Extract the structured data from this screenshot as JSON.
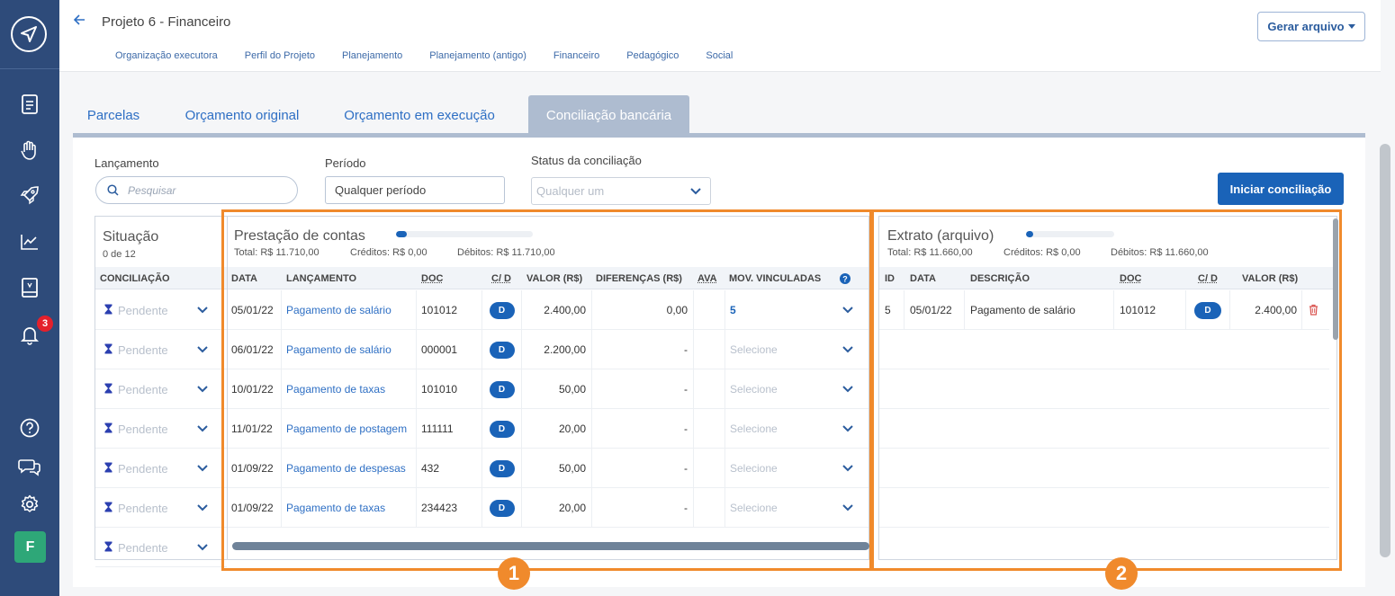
{
  "sidebar": {
    "notification_count": "3",
    "user_initial": "F"
  },
  "header": {
    "title": "Projeto 6 - Financeiro",
    "nav": [
      "Organização executora",
      "Perfil do Projeto",
      "Planejamento",
      "Planejamento (antigo)",
      "Financeiro",
      "Pedagógico",
      "Social"
    ],
    "gerar_label": "Gerar arquivo"
  },
  "tabs": [
    "Parcelas",
    "Orçamento original",
    "Orçamento em execução",
    "Conciliação bancária"
  ],
  "filters": {
    "lancamento_label": "Lançamento",
    "search_placeholder": "Pesquisar",
    "periodo_label": "Período",
    "periodo_value": "Qualquer período",
    "status_label": "Status da conciliação",
    "status_value": "Qualquer um",
    "iniciar_label": "Iniciar conciliação"
  },
  "situacao": {
    "title": "Situação",
    "count": "0 de 12",
    "header": "CONCILIAÇÃO",
    "rows": [
      "Pendente",
      "Pendente",
      "Pendente",
      "Pendente",
      "Pendente",
      "Pendente",
      "Pendente"
    ]
  },
  "prestacao": {
    "title": "Prestação de contas",
    "progress": 0.08,
    "total": "Total: R$ 11.710,00",
    "creditos": "Créditos: R$ 0,00",
    "debitos": "Débitos: R$ 11.710,00",
    "headers": [
      "DATA",
      "LANÇAMENTO",
      "DOC",
      "C/ D",
      "VALOR (R$)",
      "DIFERENÇAS (R$)",
      "AVA",
      "MOV. VINCULADAS"
    ],
    "rows": [
      {
        "data": "05/01/22",
        "lancamento": "Pagamento de salário",
        "doc": "101012",
        "cd": "D",
        "valor": "2.400,00",
        "dif": "0,00",
        "mov": "5"
      },
      {
        "data": "06/01/22",
        "lancamento": "Pagamento de salário",
        "doc": "000001",
        "cd": "D",
        "valor": "2.200,00",
        "dif": "-",
        "mov": "Selecione"
      },
      {
        "data": "10/01/22",
        "lancamento": "Pagamento de taxas",
        "doc": "101010",
        "cd": "D",
        "valor": "50,00",
        "dif": "-",
        "mov": "Selecione"
      },
      {
        "data": "11/01/22",
        "lancamento": "Pagamento de postagem",
        "doc": "111111",
        "cd": "D",
        "valor": "20,00",
        "dif": "-",
        "mov": "Selecione"
      },
      {
        "data": "01/09/22",
        "lancamento": "Pagamento de despesas",
        "doc": "432",
        "cd": "D",
        "valor": "50,00",
        "dif": "-",
        "mov": "Selecione"
      },
      {
        "data": "01/09/22",
        "lancamento": "Pagamento de taxas",
        "doc": "234423",
        "cd": "D",
        "valor": "20,00",
        "dif": "-",
        "mov": "Selecione"
      }
    ]
  },
  "extrato": {
    "title": "Extrato (arquivo)",
    "progress": 0.08,
    "total": "Total: R$ 11.660,00",
    "creditos": "Créditos: R$ 0,00",
    "debitos": "Débitos: R$ 11.660,00",
    "headers": [
      "ID",
      "DATA",
      "DESCRIÇÃO",
      "DOC",
      "C/ D",
      "VALOR (R$)"
    ],
    "rows": [
      {
        "id": "5",
        "data": "05/01/22",
        "descricao": "Pagamento de salário",
        "doc": "101012",
        "cd": "D",
        "valor": "2.400,00"
      }
    ]
  },
  "annotations": [
    "1",
    "2"
  ],
  "colors": {
    "sidebar": "#2e4b7a",
    "accent": "#1a63b8",
    "highlight": "#f08a2c"
  }
}
